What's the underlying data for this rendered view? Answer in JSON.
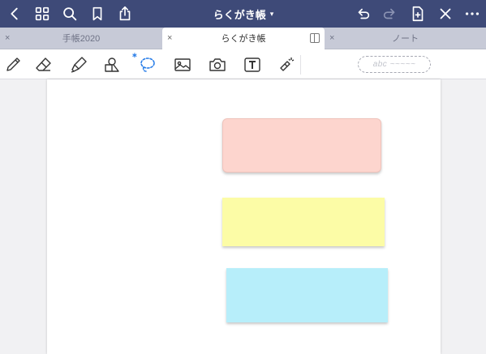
{
  "topbar": {
    "background": "#3e4a78",
    "title": "らくがき帳",
    "icons": [
      "back-icon",
      "grid-icon",
      "search-icon",
      "bookmark-icon",
      "share-icon",
      "undo-icon",
      "redo-icon",
      "add-page-icon",
      "close-icon",
      "more-icon"
    ]
  },
  "tabs": [
    {
      "label": "手帳2020",
      "close": "×",
      "active": false
    },
    {
      "label": "らくがき帳",
      "close": "×",
      "active": true
    },
    {
      "label": "ノート",
      "close": "×",
      "active": false
    }
  ],
  "toolbar": {
    "tools": [
      "pen-icon",
      "eraser-icon",
      "highlighter-icon",
      "shapes-icon",
      "lasso-icon",
      "image-icon",
      "camera-icon",
      "text-icon",
      "laser-icon"
    ],
    "bluetooth_mark": "∗",
    "handwriting_placeholder": "abc ~~~~~",
    "accent_color": "#2a7ee8"
  },
  "canvas": {
    "notes": [
      {
        "color": "#fdd5ce"
      },
      {
        "color": "#fcfca6"
      },
      {
        "color": "#b7eefa"
      }
    ]
  }
}
